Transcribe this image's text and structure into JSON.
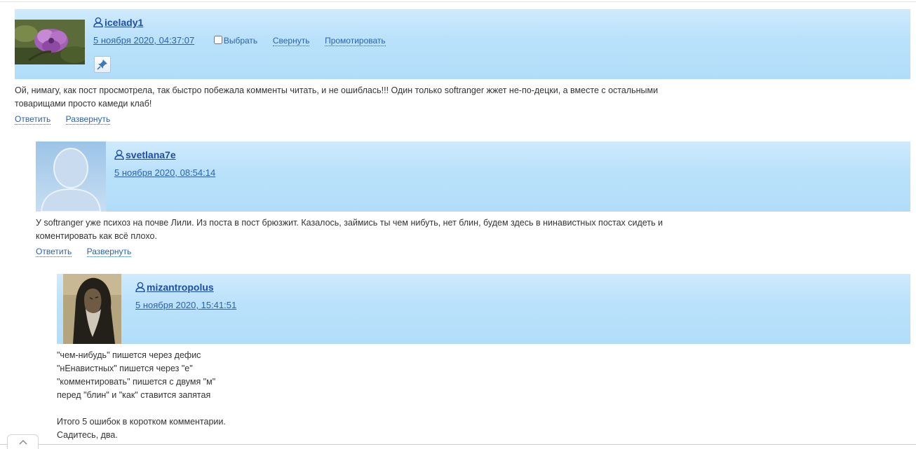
{
  "colors": {
    "header_bg": "#b9e1fb",
    "link": "#2d62b0",
    "username": "#1d4fa8"
  },
  "icons": {
    "user": "user-icon",
    "pin": "pin-icon",
    "scroll_top": "chevron-up-icon"
  },
  "comments": [
    {
      "username": "icelady1",
      "date": "5 ноября 2020, 04:37:07",
      "select_label": "Выбрать",
      "collapse_label": "Свернуть",
      "promote_label": "Промотировать",
      "body": [
        "Ой, нимагу, как пост просмотрела, так быстро побежала комменты читать, и не ошиблась!!! Один только softranger жжет не-по-децки, а вместе с остальными",
        "товарищами просто камеди клаб!"
      ],
      "reply_label": "Ответить",
      "expand_label": "Развернуть"
    },
    {
      "username": "svetlana7e",
      "date": "5 ноября 2020, 08:54:14",
      "body": [
        "У softranger уже психоз на почве Лили. Из поста в пост брюзжит. Казалось, займись ты чем нибуть, нет блин, будем здесь в нинавистных постах сидеть и",
        "коментировать как всё плохо."
      ],
      "reply_label": "Ответить",
      "expand_label": "Развернуть"
    },
    {
      "username": "mizantropolus",
      "date": "5 ноября 2020, 15:41:51",
      "body": [
        "\"чем-нибудь\" пишется через дефис",
        "\"нЕнавистных\" пишется через \"е\"",
        "\"комментировать\" пишется с двумя \"м\"",
        "перед \"блин\" и \"как\" ставится запятая",
        "",
        "Итого 5 ошибок в коротком комментарии.",
        "Садитесь, два."
      ]
    }
  ]
}
